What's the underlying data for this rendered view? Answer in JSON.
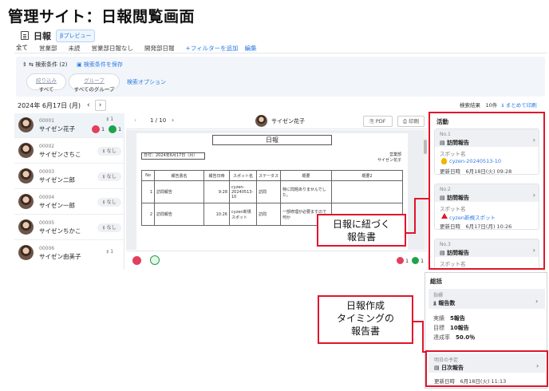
{
  "heading": "管理サイト：日報閲覧画面",
  "header": {
    "title": "日報",
    "preview_label": "βプレビュー",
    "tabs": [
      "全て",
      "営業部",
      "未読",
      "営業部日報なし",
      "開発部日報"
    ],
    "add_filter": "+フィルターを追加",
    "edit": "編集"
  },
  "search": {
    "condition_label": "検索条件 (2)",
    "save_condition": "検索条件を保存",
    "filters": [
      {
        "label": "絞り込み",
        "value": "すべて"
      },
      {
        "label": "グループ",
        "value": "すべてのグループ"
      }
    ],
    "options_link": "検索オプション"
  },
  "date_nav": {
    "date": "2024年 6月17日 (月)",
    "prev": "‹",
    "next": "›"
  },
  "results": {
    "count_text": "検索結果　10件",
    "bulk_print": "まとめて印刷"
  },
  "users": [
    {
      "id": "00001",
      "name": "サイゼン花子",
      "count": "1",
      "heart": "1",
      "chat": "1"
    },
    {
      "id": "00002",
      "name": "サイゼンさちこ",
      "status": "なし"
    },
    {
      "id": "00003",
      "name": "サイゼン二郎",
      "status": "なし"
    },
    {
      "id": "00004",
      "name": "サイゼン一郎",
      "status": "なし"
    },
    {
      "id": "00005",
      "name": "サイゼンちかこ",
      "status": "なし"
    },
    {
      "id": "00006",
      "name": "サイゼン由美子",
      "count": "1"
    }
  ],
  "viewer": {
    "prev": "‹",
    "page": "1 / 10",
    "next": "›",
    "user_name": "サイゼン花子",
    "pdf_label": "PDF",
    "print_label": "印刷",
    "doc": {
      "title": "日報",
      "date_label": "日付：2024年6月17日（月）",
      "dept": "営業部",
      "person": "サイゼン花子",
      "columns": [
        "No",
        "報告書名",
        "報告日時",
        "スポット名",
        "ステータス",
        "概要",
        "概要2"
      ],
      "rows": [
        [
          "1",
          "訪問報告",
          "9:28",
          "cyzen-20240513-10",
          "訪問",
          "特に問題ありませんでした。",
          ""
        ],
        [
          "2",
          "訪問報告",
          "10:26",
          "cyzen新規スポット",
          "訪問",
          "一部修理が必要ますので何か",
          ""
        ]
      ]
    },
    "bottom_heart": "1",
    "bottom_chat": "1"
  },
  "activity": {
    "title": "活動",
    "cards": [
      {
        "no": "No.1",
        "type": "訪問報告",
        "spot_label": "スポット名",
        "spot": "cyzen-20240513-10",
        "updated": "更新日時　6月18日(火) 09:28"
      },
      {
        "no": "No.2",
        "type": "訪問報告",
        "spot_label": "スポット名",
        "spot": "cyzen新規スポット",
        "updated": "更新日時　6月17日(月) 10:26"
      },
      {
        "no": "No.3",
        "type": "訪問報告",
        "spot_label": "スポット名"
      }
    ]
  },
  "summary": {
    "title": "総括",
    "metric_category": "指標",
    "metric_title": "報告数",
    "actual_label": "実績",
    "actual_value": "5報告",
    "target_label": "目標",
    "target_value": "10報告",
    "rate_label": "達成率",
    "rate_value": "50.0％",
    "plan_category": "明日の予定",
    "plan_title": "日次報告",
    "plan_updated": "更新日時　6月18日(火) 11:13"
  },
  "annotations": {
    "callout1": [
      "日報に紐づく",
      "報告書"
    ],
    "callout2": [
      "日報作成",
      "タイミングの",
      "報告書"
    ]
  },
  "colors": {
    "accent": "#2c7be5",
    "annotation": "#e0162b",
    "heart": "#e43e5d",
    "chat": "#1fa34a"
  }
}
